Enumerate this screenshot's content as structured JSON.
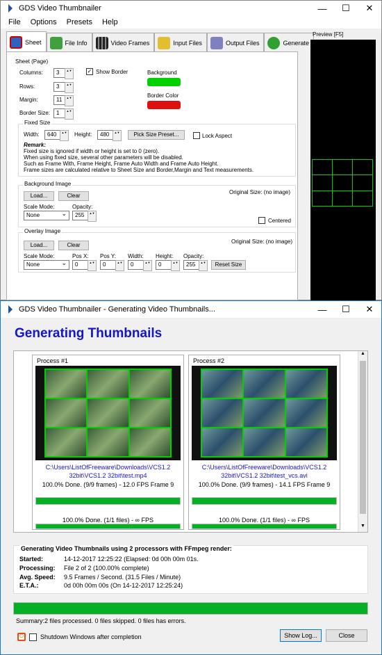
{
  "win1": {
    "title": "GDS Video Thumbnailer",
    "menu": [
      "File",
      "Options",
      "Presets",
      "Help"
    ],
    "tabs": [
      {
        "label": "Sheet",
        "icon": "sheet-icon",
        "color": "#3060c0"
      },
      {
        "label": "File Info",
        "icon": "file-info-icon",
        "color": "#40a040"
      },
      {
        "label": "Video Frames",
        "icon": "film-icon",
        "color": "#555555"
      },
      {
        "label": "Input Files",
        "icon": "folder-icon",
        "color": "#e0c030"
      },
      {
        "label": "Output Files",
        "icon": "output-icon",
        "color": "#8080c0"
      },
      {
        "label": "Generate",
        "icon": "generate-icon",
        "color": "#30a030"
      }
    ],
    "preview_label": "Preview  [F5]",
    "sheet": {
      "group": "Sheet (Page)",
      "columns_label": "Columns:",
      "columns": "3",
      "rows_label": "Rows:",
      "rows": "3",
      "margin_label": "Margin:",
      "margin": "11",
      "border_label": "Border Size:",
      "border": "1",
      "show_border": "Show Border",
      "background_label": "Background",
      "background_color": "#00d000",
      "border_color_label": "Border Color",
      "border_color": "#e01010"
    },
    "fixed": {
      "group": "Fixed Size",
      "width_label": "Width:",
      "width": "640",
      "height_label": "Height:",
      "height": "480",
      "pick": "Pick Size Preset...",
      "lock": "Lock Aspect",
      "remark_title": "Remark:",
      "remark": [
        "Fixed size is ignored if width or height is set to 0 (zero).",
        "When using fixed size, several other parameters will be disabled.",
        "Such as Frame With, Frame Height, Frame Auto Width and Frame Auto Height.",
        "Frame sizes are calculated relative to Sheet Size and Border,Margin and Text measurements."
      ]
    },
    "bgimage": {
      "group": "Background Image",
      "load": "Load...",
      "clear": "Clear",
      "original": "Original Size:  (no image)",
      "scale_label": "Scale Mode:",
      "scale": "None",
      "opacity_label": "Opacity:",
      "opacity": "255",
      "centered": "Centered"
    },
    "overlay": {
      "group": "Overlay Image",
      "load": "Load...",
      "clear": "Clear",
      "original": "Original Size:  (no image)",
      "scale_label": "Scale Mode:",
      "scale": "None",
      "posx_label": "Pos X:",
      "posx": "0",
      "posy_label": "Pos Y:",
      "posy": "0",
      "width_label": "Width:",
      "width": "0",
      "height_label": "Height:",
      "height": "0",
      "opacity_label": "Opacity:",
      "opacity": "255",
      "reset": "Reset Size"
    }
  },
  "win2": {
    "title": "GDS Video Thumbnailer - Generating Video Thumbnails...",
    "heading": "Generating Thumbnails",
    "processes": [
      {
        "title": "Process #1",
        "path1": "C:\\Users\\ListOfFreeware\\Downloads\\VCS1.2",
        "path2": "32bit\\VCS1.2 32bit\\test.mp4",
        "status": "100.0% Done. (9/9 frames) - 12.0 FPS Frame 9",
        "progress": 1.0,
        "files": "100.0% Done. (1/1 files) - ∞ FPS",
        "files_progress": 1.0
      },
      {
        "title": "Process #2",
        "path1": "C:\\Users\\ListOfFreeware\\Downloads\\VCS1.2",
        "path2": "32bit\\VCS1.2 32bit\\test_vcs.avi",
        "status": "100.0% Done. (9/9 frames) - 14.1 FPS Frame 9",
        "progress": 1.0,
        "files": "100.0% Done. (1/1 files) - ∞ FPS",
        "files_progress": 1.0
      }
    ],
    "info": {
      "title": "Generating Video Thumbnails using 2 processors with FFmpeg render:",
      "started_label": "Started:",
      "started": "14-12-2017 12:25:22 (Elapsed: 0d 00h 00m 01s.",
      "processing_label": "Processing:",
      "processing": "File 2 of 2 (100.00% complete)",
      "speed_label": "Avg. Speed:",
      "speed": "9.5 Frames / Second. (31.5 Files / Minute)",
      "eta_label": "E.T.A.:",
      "eta": "0d 00h 00m 00s (On 14-12-2017 12:25:24)"
    },
    "overall_progress": 1.0,
    "summary": "Summary:2 files processed. 0 files skipped. 0 files has errors.",
    "shutdown": "Shutdown Windows after completion",
    "show_log": "Show Log...",
    "close": "Close"
  }
}
